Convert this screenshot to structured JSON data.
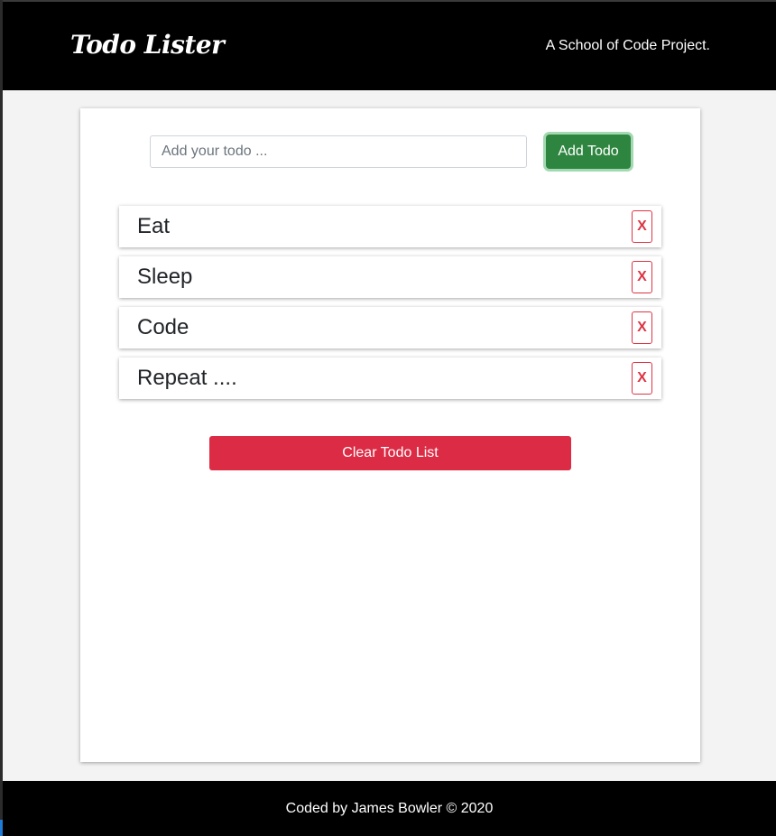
{
  "navbar": {
    "brand": "Todo Lister",
    "tagline": "A School of Code Project."
  },
  "form": {
    "input_placeholder": "Add your todo ...",
    "input_value": "",
    "add_label": "Add Todo"
  },
  "todos": [
    {
      "text": "Eat",
      "delete_label": "X"
    },
    {
      "text": "Sleep",
      "delete_label": "X"
    },
    {
      "text": "Code",
      "delete_label": "X"
    },
    {
      "text": "Repeat ....",
      "delete_label": "X"
    }
  ],
  "clear_label": "Clear Todo List",
  "footer": {
    "text": "Coded by James Bowler © 2020"
  },
  "colors": {
    "navbar_bg": "#000000",
    "add_button": "#2e8540",
    "danger": "#dc3545",
    "clear_button": "#dc2b45",
    "page_bg": "#f3f3f3"
  }
}
